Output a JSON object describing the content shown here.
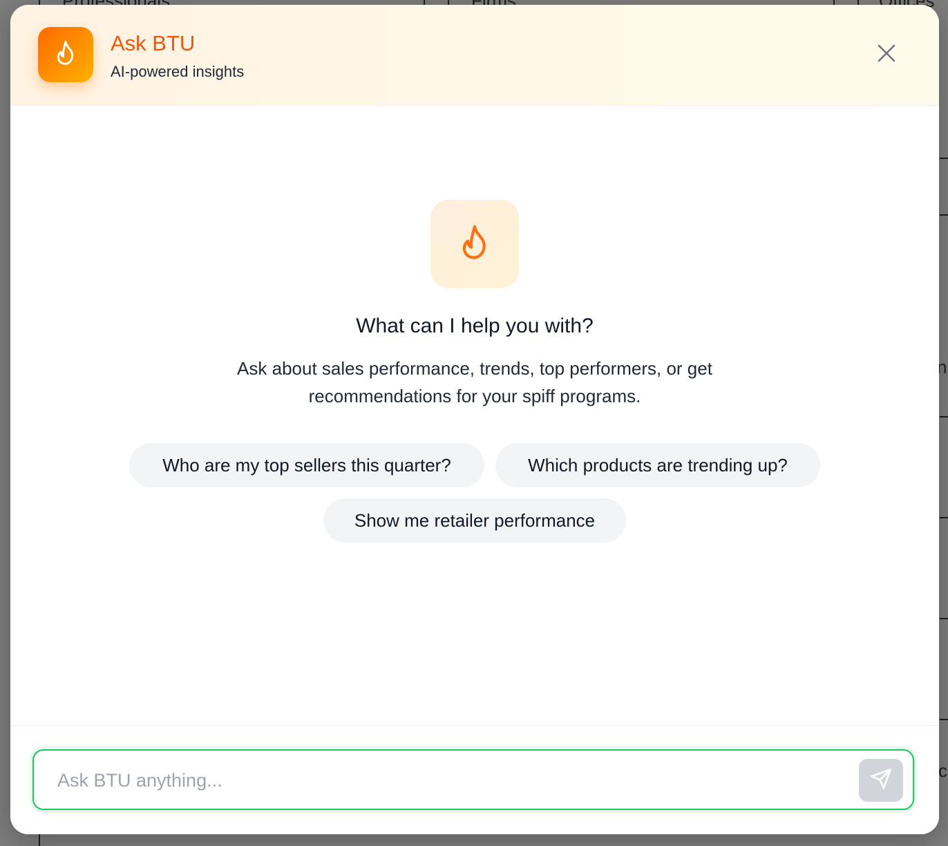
{
  "background": {
    "col1_header": "Professionals",
    "col2_header": "Firms",
    "col3_header": "Offices",
    "right_edge_fragment_1": "n",
    "right_edge_fragment_2": "c"
  },
  "header": {
    "title": "Ask BTU",
    "subtitle": "AI-powered insights",
    "logo_icon": "flame-icon",
    "close_icon": "close-icon"
  },
  "hero": {
    "icon": "flame-icon",
    "title": "What can I help you with?",
    "description": "Ask about sales performance, trends, top performers, or get recommendations for your spiff programs."
  },
  "suggestions": [
    {
      "label": "Who are my top sellers this quarter?"
    },
    {
      "label": "Which products are trending up?"
    },
    {
      "label": "Show me retailer performance"
    }
  ],
  "composer": {
    "placeholder": "Ask BTU anything...",
    "value": "",
    "send_icon": "send-icon"
  },
  "colors": {
    "accent": "#ea580c",
    "brand_gradient_start": "#ff6a00",
    "brand_gradient_end": "#ffb000",
    "input_focus": "#22c55e",
    "chip_bg": "#f3f4f6",
    "send_disabled_bg": "#d1d5db"
  }
}
